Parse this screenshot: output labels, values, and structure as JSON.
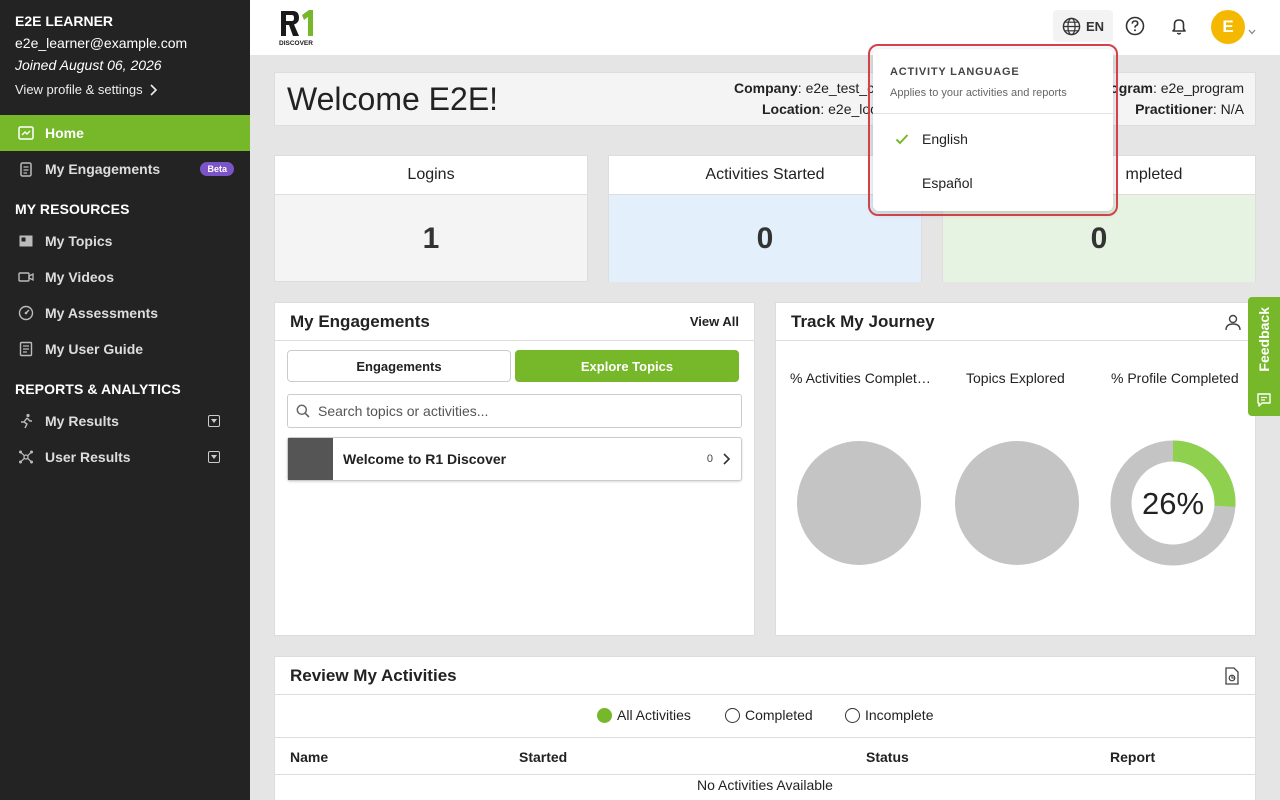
{
  "sidebar": {
    "user_name": "E2E LEARNER",
    "user_email": "e2e_learner@example.com",
    "joined": "Joined August 06, 2026",
    "profile_link": "View profile & settings",
    "home": "Home",
    "engagements": "My Engagements",
    "beta": "Beta",
    "resources_head": "MY RESOURCES",
    "topics": "My Topics",
    "videos": "My Videos",
    "assessments": "My Assessments",
    "guide": "My User Guide",
    "reports_head": "REPORTS & ANALYTICS",
    "results": "My Results",
    "user_results": "User Results"
  },
  "topbar": {
    "logo_text": "DISCOVER",
    "lang_code": "EN",
    "avatar_letter": "E"
  },
  "welcome": {
    "title": "Welcome E2E!",
    "company_label": "Company",
    "company_value": "e2e_test_c",
    "location_label": "Location",
    "location_value": "e2e_loc",
    "program_label": "ogram",
    "program_value": "e2e_program",
    "practitioner_label": "Practitioner",
    "practitioner_value": "N/A"
  },
  "stats": {
    "logins_title": "Logins",
    "logins_value": "1",
    "started_title": "Activities Started",
    "started_value": "0",
    "completed_title": "mpleted",
    "completed_value": "0"
  },
  "engagements": {
    "title": "My Engagements",
    "view_all": "View All",
    "tab_engagements": "Engagements",
    "tab_explore": "Explore Topics",
    "search_placeholder": "Search topics or activities...",
    "item_title": "Welcome to R1 Discover",
    "item_count": "0"
  },
  "journey": {
    "title": "Track My Journey",
    "label_activities": "% Activities Complet…",
    "label_topics": "Topics Explored",
    "label_profile": "% Profile Completed",
    "profile_percent_text": "26%",
    "profile_percent": 26,
    "accent_color": "#8fd14f",
    "track_color": "#c4c4c4"
  },
  "activities": {
    "title": "Review My Activities",
    "filter_all": "All Activities",
    "filter_completed": "Completed",
    "filter_incomplete": "Incomplete",
    "col_name": "Name",
    "col_started": "Started",
    "col_status": "Status",
    "col_report": "Report",
    "empty": "No Activities Available"
  },
  "feedback": "Feedback",
  "language_menu": {
    "title": "ACTIVITY LANGUAGE",
    "subtitle": "Applies to your activities and reports",
    "options": [
      "English",
      "Español"
    ],
    "selected": "English"
  },
  "colors": {
    "brand_green": "#76b82a",
    "sidebar_bg": "#232323",
    "avatar": "#f5b800",
    "highlight_outline": "#d0434a"
  }
}
